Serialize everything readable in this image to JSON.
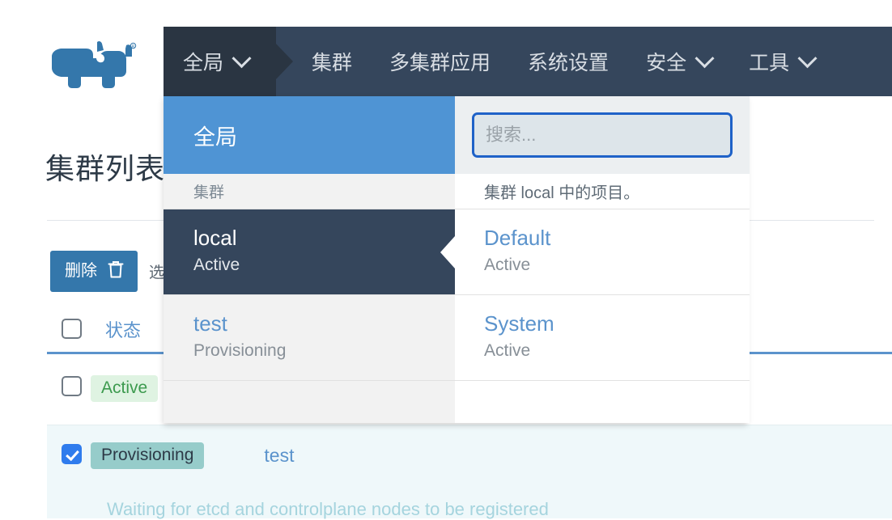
{
  "brand": {
    "logo_name": "rancher-cow-logo",
    "color": "#3477ab"
  },
  "navbar": {
    "context": {
      "label": "全局",
      "caret_icon": "chevron-down-icon"
    },
    "items": [
      {
        "label": "集群",
        "has_caret": false
      },
      {
        "label": "多集群应用",
        "has_caret": false
      },
      {
        "label": "系统设置",
        "has_caret": false
      },
      {
        "label": "安全",
        "has_caret": true
      },
      {
        "label": "工具",
        "has_caret": true
      }
    ]
  },
  "dropdown": {
    "left": {
      "global_label": "全局",
      "section_label": "集群",
      "clusters": [
        {
          "name": "local",
          "state": "Active",
          "selected": true
        },
        {
          "name": "test",
          "state": "Provisioning",
          "selected": false
        }
      ]
    },
    "right": {
      "search_value": "",
      "search_placeholder": "搜索...",
      "section_label": "集群 local 中的项目。",
      "projects": [
        {
          "name": "Default",
          "state": "Active"
        },
        {
          "name": "System",
          "state": "Active"
        }
      ]
    }
  },
  "page": {
    "title": "集群列表",
    "toolbar": {
      "delete_label": "删除",
      "delete_icon": "trash-icon",
      "hint": "选"
    },
    "table": {
      "columns": [
        "状态"
      ],
      "rows": [
        {
          "checked": false,
          "state": "Active",
          "state_kind": "active",
          "name": "",
          "message": ""
        },
        {
          "checked": true,
          "state": "Provisioning",
          "state_kind": "provisioning",
          "name": "test",
          "message": "Waiting for etcd and controlplane nodes to be registered"
        }
      ]
    }
  },
  "colors": {
    "navbar_bg": "#35465c",
    "navbar_context_bg": "#2a3542",
    "accent_blue": "#4f94d4",
    "link_blue": "#5b93cc",
    "button_blue": "#3477ab",
    "focus_border": "#1f62c8",
    "badge_active_bg": "#dff3e2",
    "badge_active_fg": "#3c9a4e",
    "badge_provisioning_bg": "#96ccca",
    "row_highlight_bg": "#eff8fa"
  }
}
